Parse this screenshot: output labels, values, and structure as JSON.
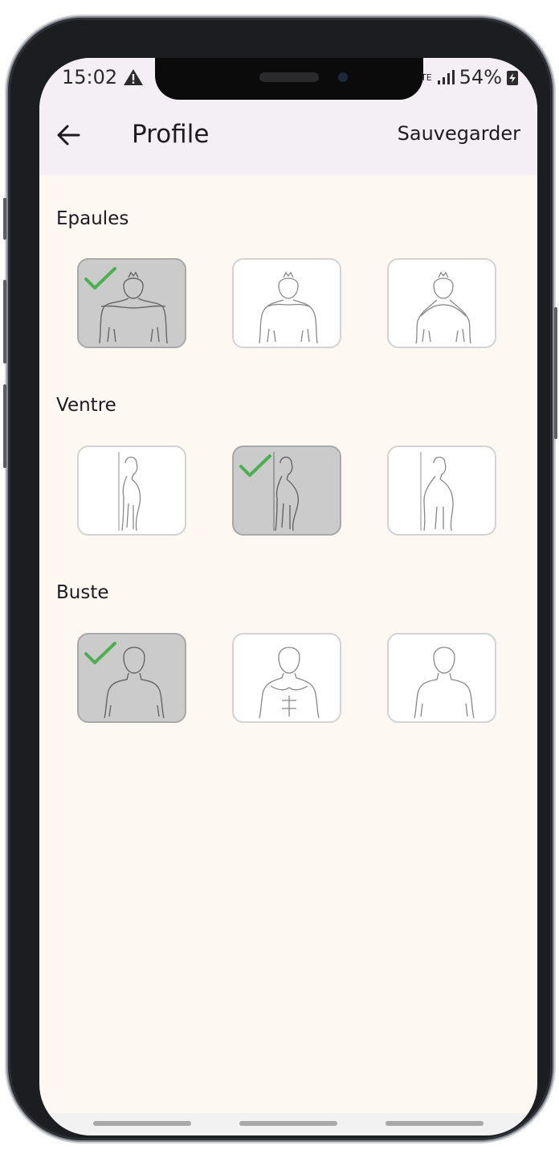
{
  "status_bar": {
    "time": "15:02",
    "network": "LTE",
    "battery": "54%"
  },
  "header": {
    "title": "Profile",
    "save_label": "Sauvegarder"
  },
  "sections": [
    {
      "label": "Epaules",
      "selected_index": 0,
      "icon": "shoulders-figure"
    },
    {
      "label": "Ventre",
      "selected_index": 1,
      "icon": "belly-profile-figure"
    },
    {
      "label": "Buste",
      "selected_index": 0,
      "icon": "bust-figure"
    }
  ],
  "colors": {
    "appbar": "#f4eff4",
    "background": "#fdf8f1",
    "selected_option": "#cbcbcb",
    "check": "#4caf50"
  }
}
